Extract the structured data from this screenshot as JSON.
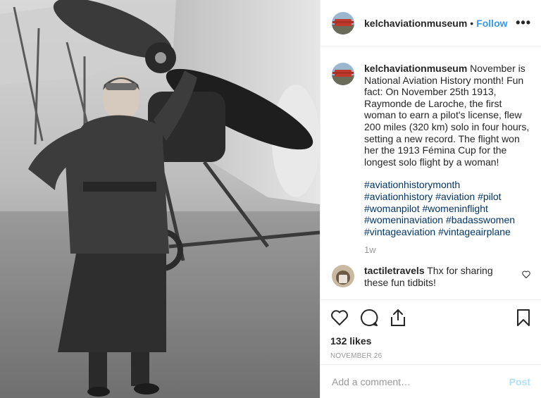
{
  "post": {
    "image_alt": "Black and white photo of an aviator standing beside a biplane propeller"
  },
  "header": {
    "username": "kelchaviationmuseum",
    "separator": "•",
    "follow_label": "Follow",
    "more_label": "•••"
  },
  "caption": {
    "username": "kelchaviationmuseum",
    "text": "November is National Aviation History month! Fun fact: On November 25th 1913, Raymonde de Laroche, the first woman to earn a pilot's license, flew 200 miles (320 km) solo in four hours, setting a new record. The flight won her the 1913 Fémina Cup for the longest solo flight by a woman!",
    "hashtags": [
      "#aviationhistorymonth",
      "#aviationhistory #aviation #pilot",
      "#womanpilot #womeninflight",
      "#womeninaviation #badasswomen",
      "#vintageaviation #vintageairplane"
    ],
    "time": "1w"
  },
  "reply": {
    "username": "tactiletravels",
    "text": "Thx for sharing these fun tidbits!"
  },
  "actions": {
    "likes": "132 likes",
    "date": "NOVEMBER 26"
  },
  "add_comment": {
    "placeholder": "Add a comment…",
    "post_label": "Post"
  },
  "colors": {
    "link": "#3897f0",
    "hashtag": "#003569",
    "muted": "#999999",
    "post_disabled": "#b2dffc"
  }
}
